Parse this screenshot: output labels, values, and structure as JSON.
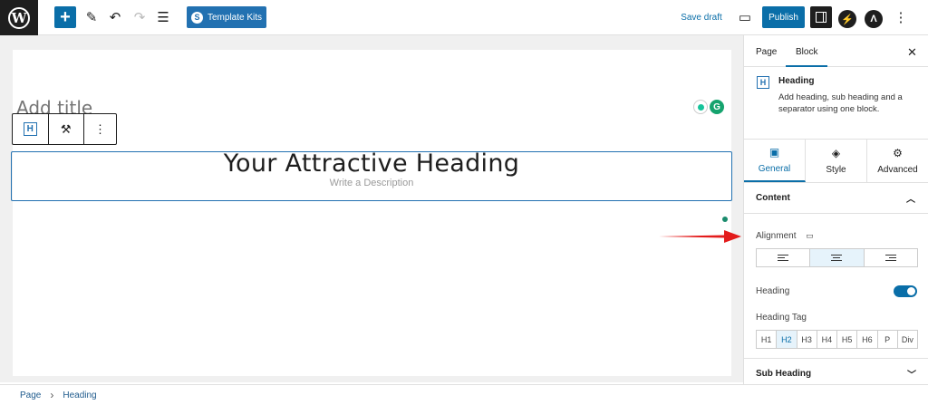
{
  "toolbar": {
    "wp_logo": "W",
    "template_kits_label": "Template Kits",
    "save_draft_label": "Save draft",
    "publish_label": "Publish"
  },
  "editor": {
    "title_placeholder": "Add title",
    "heading_text": "Your Attractive Heading",
    "description_placeholder": "Write a Description"
  },
  "breadcrumb": [
    "Page",
    "Heading"
  ],
  "sidebar": {
    "tabs": [
      "Page",
      "Block"
    ],
    "active_tab": "Block",
    "block": {
      "icon_letter": "H",
      "name": "Heading",
      "description": "Add heading, sub heading and a separator using one block."
    },
    "sub_tabs": [
      "General",
      "Style",
      "Advanced"
    ],
    "active_sub_tab": "General",
    "content_section": "Content",
    "alignment_label": "Alignment",
    "alignment_options": [
      "left",
      "center",
      "right"
    ],
    "alignment_selected": "center",
    "heading_toggle_label": "Heading",
    "heading_toggle_on": true,
    "heading_tag_label": "Heading Tag",
    "heading_tags": [
      "H1",
      "H2",
      "H3",
      "H4",
      "H5",
      "H6",
      "P",
      "Div"
    ],
    "heading_tag_selected": "H2",
    "sub_heading_section": "Sub Heading"
  },
  "colors": {
    "accent": "#0a6ea8",
    "annotation_arrow": "#e31b1b"
  }
}
